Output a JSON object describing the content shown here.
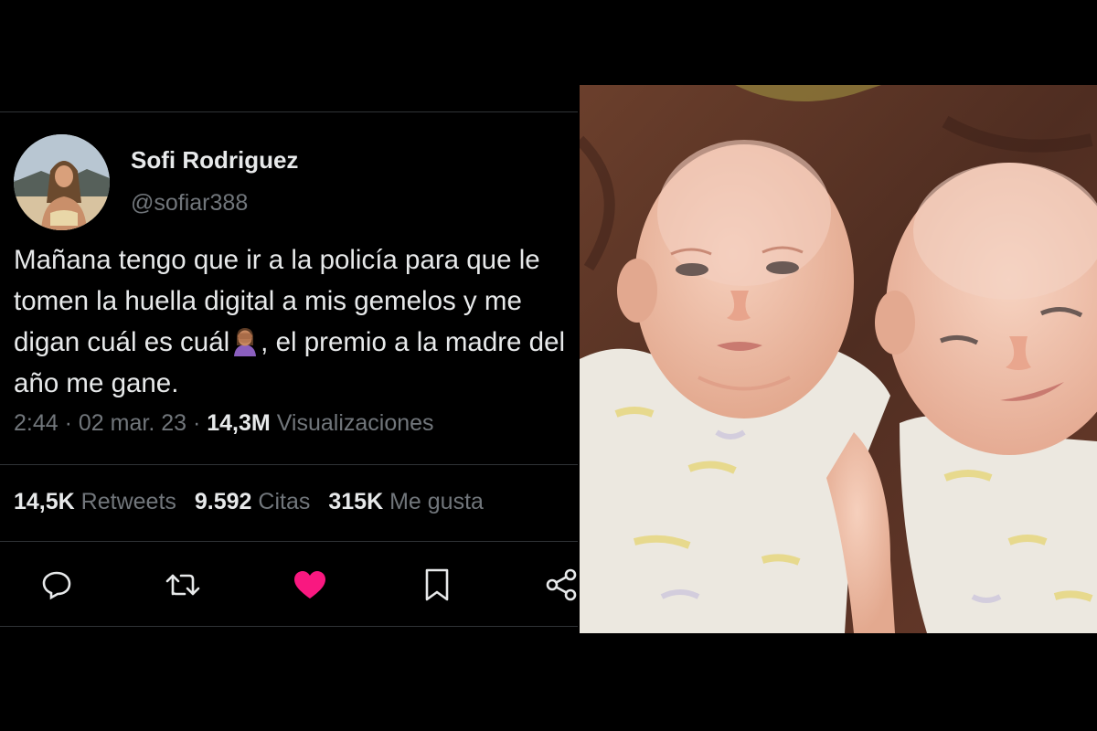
{
  "tweet": {
    "author_name": "Sofi Rodriguez",
    "author_handle": "@sofiar388",
    "text_before_emoji": "Mañana tengo que ir a la policía para que le tomen la huella digital a mis gemelos y me digan cuál es cuál",
    "emoji": "woman-facepalming-emoji",
    "text_after_emoji": ", el premio a la madre del año me gane.",
    "time": "2:44",
    "date": "02 mar. 23",
    "views_count": "14,3M",
    "views_label": "Visualizaciones",
    "retweets_count": "14,5K",
    "retweets_label": "Retweets",
    "quotes_count": "9.592",
    "quotes_label": "Citas",
    "likes_count": "315K",
    "likes_label": "Me gusta",
    "liked": true
  },
  "actions": [
    "reply-icon",
    "retweet-icon",
    "like-icon",
    "bookmark-icon",
    "share-icon"
  ],
  "photo": {
    "subject": "twin newborn babies lying on a brown blanket"
  },
  "colors": {
    "background": "#000000",
    "primary_text": "#e7e9ea",
    "secondary_text": "#71767b",
    "divider": "#2f3336",
    "like_pink": "#f91880"
  }
}
